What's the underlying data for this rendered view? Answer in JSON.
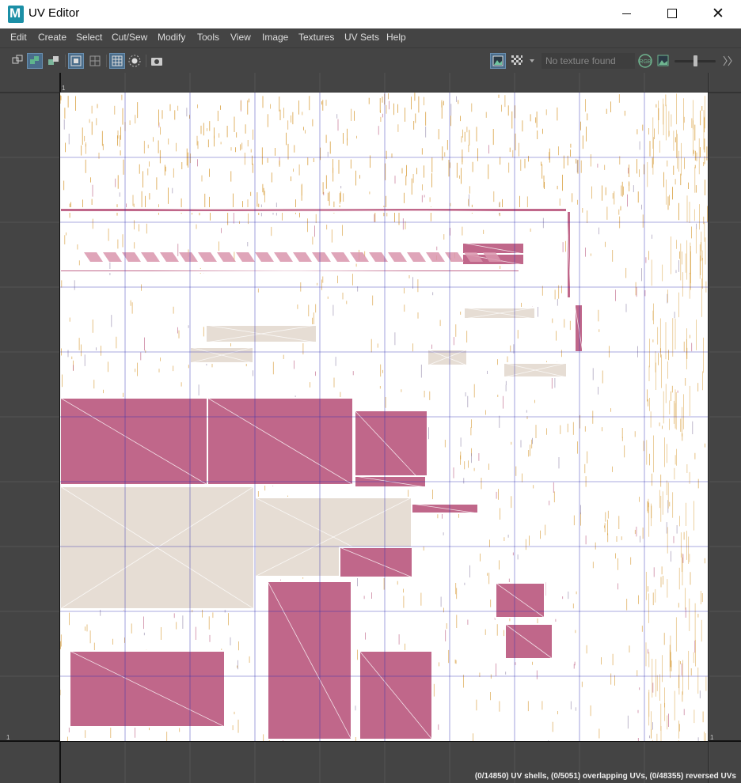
{
  "window": {
    "title": "UV Editor",
    "logo_letter": "M",
    "controls": {
      "minimize": "—",
      "maximize": "☐",
      "close": "✕"
    }
  },
  "menu": [
    "Edit",
    "Create",
    "Select",
    "Cut/Sew",
    "Modify",
    "Tools",
    "View",
    "Image",
    "Textures",
    "UV Sets",
    "Help"
  ],
  "toolbar": {
    "texture_status": "No texture found",
    "rgb_label": "RGB"
  },
  "viewport": {
    "axis_labels": {
      "top_left": "1",
      "bottom_left": "1",
      "bottom_right": "1"
    },
    "status": "(0/14850) UV shells, (0/5051) overlapping UVs, (0/48355) reversed UVs"
  },
  "colors": {
    "uv_fill": "#c0678a",
    "uv_fill_light": "#d995ad",
    "uv_edge": "#ffffff",
    "uv_seam": "#d9a040",
    "beige_fill": "#e6ddd4",
    "grid_line": "#2b2bb0",
    "background": "#444444"
  }
}
